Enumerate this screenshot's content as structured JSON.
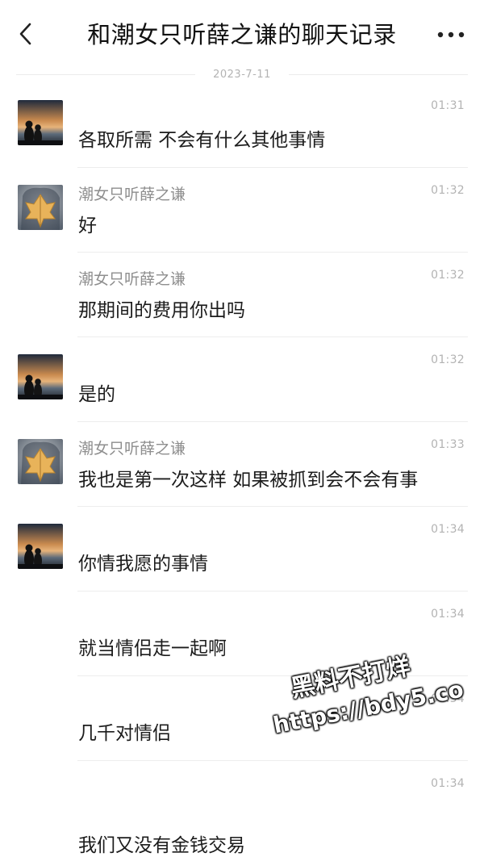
{
  "header": {
    "title": "和潮女只听薛之谦的聊天记录",
    "back_icon": "chevron-left-icon",
    "more_icon": "more-horizontal-icon"
  },
  "date_divider": "2023-7-11",
  "messages": [
    {
      "sender": "",
      "avatar": "sunset-couple",
      "time": "01:31",
      "text": "各取所需 不会有什么其他事情"
    },
    {
      "sender": "潮女只听薛之谦",
      "avatar": "leaf-face",
      "time": "01:32",
      "text": "好"
    },
    {
      "sender": "潮女只听薛之谦",
      "avatar": "",
      "time": "01:32",
      "text": "那期间的费用你出吗"
    },
    {
      "sender": "",
      "avatar": "sunset-couple",
      "time": "01:32",
      "text": "是的"
    },
    {
      "sender": "潮女只听薛之谦",
      "avatar": "leaf-face",
      "time": "01:33",
      "text": "我也是第一次这样 如果被抓到会不会有事"
    },
    {
      "sender": "",
      "avatar": "sunset-couple",
      "time": "01:34",
      "text": "你情我愿的事情"
    },
    {
      "sender": "",
      "avatar": "",
      "time": "01:34",
      "text": "就当情侣走一起啊"
    },
    {
      "sender": "",
      "avatar": "",
      "time": "01:34",
      "text": "几千对情侣"
    },
    {
      "sender": "",
      "avatar": "",
      "time": "01:34",
      "text": "我们又没有金钱交易"
    }
  ],
  "watermark": {
    "line1": "黑料不打烊",
    "line2": "https://bdy5.co"
  }
}
